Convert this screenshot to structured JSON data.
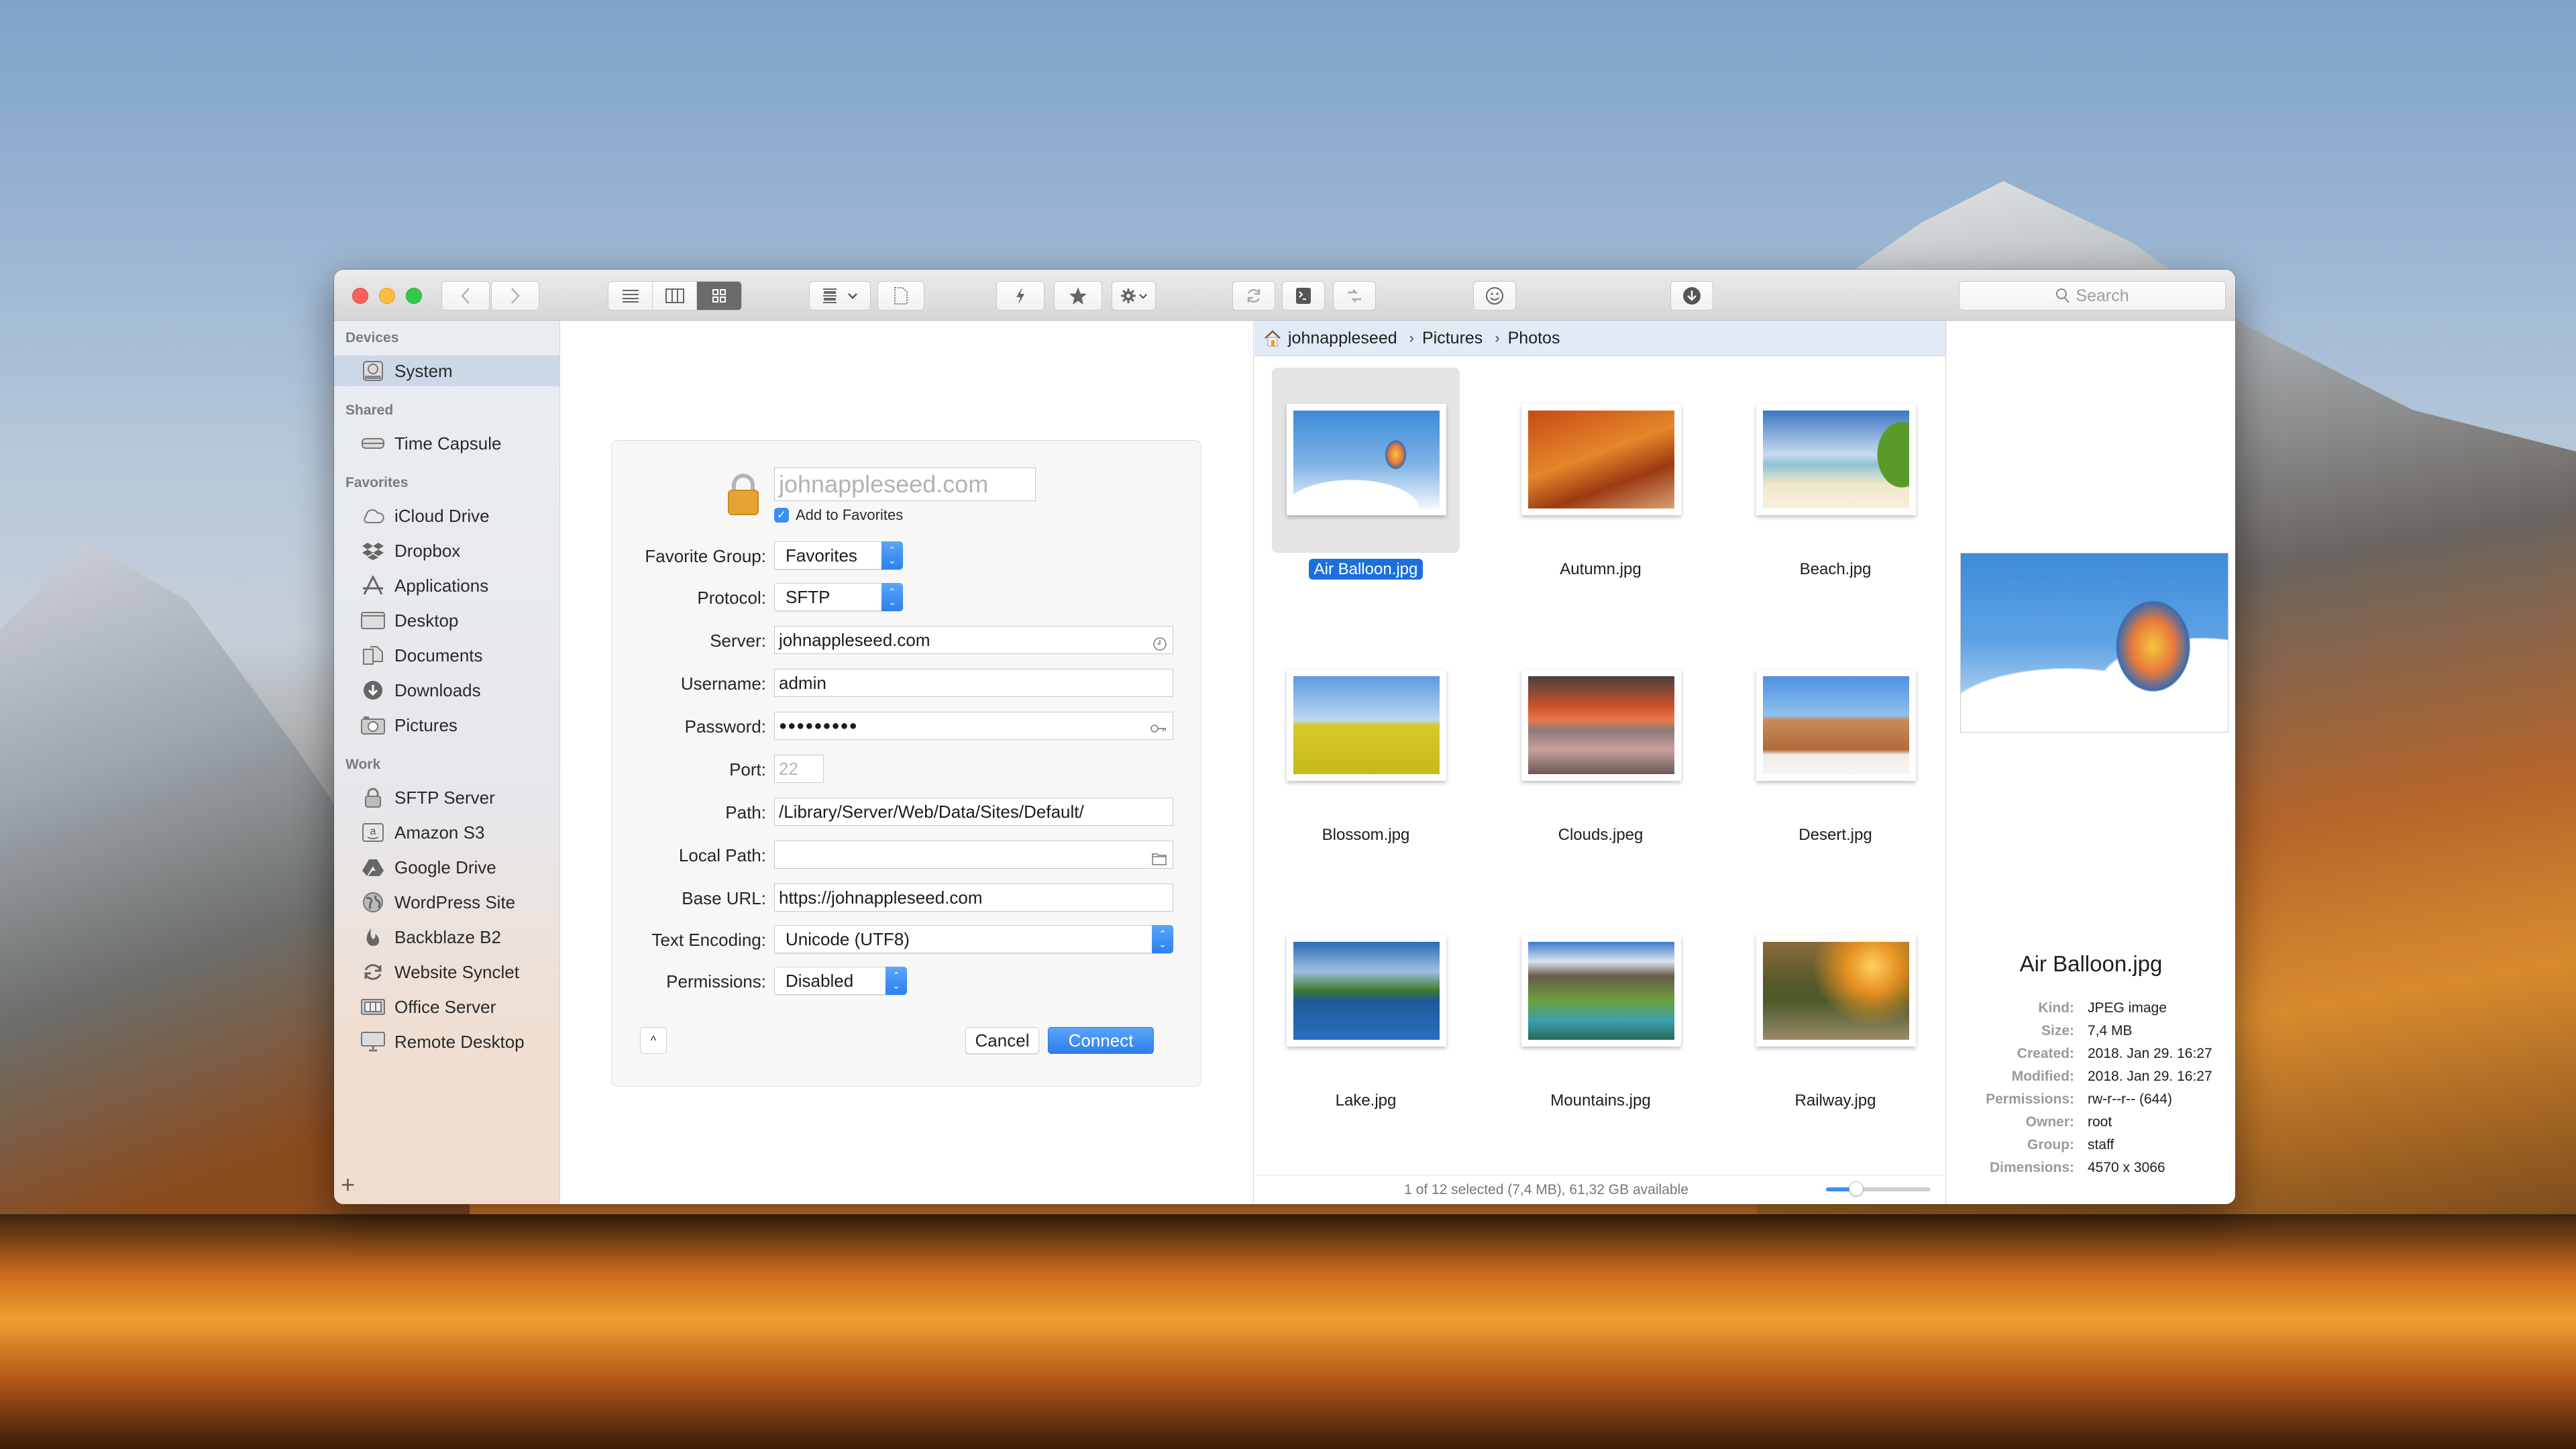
{
  "toolbar": {
    "window_controls": [
      "close",
      "minimize",
      "maximize"
    ],
    "nav": [
      "back",
      "forward"
    ],
    "view_modes": [
      {
        "name": "list",
        "icon": "list-icon",
        "active": false
      },
      {
        "name": "columns",
        "icon": "columns-icon",
        "active": false
      },
      {
        "name": "icons",
        "icon": "grid-icon",
        "active": true
      }
    ],
    "buttons": [
      {
        "name": "arrange",
        "icon": "arrange-icon"
      },
      {
        "name": "new-file",
        "icon": "new-file-icon"
      },
      {
        "name": "quick-connect",
        "icon": "lightning-icon"
      },
      {
        "name": "favorites",
        "icon": "star-icon"
      },
      {
        "name": "action",
        "icon": "gear-icon"
      },
      {
        "name": "sync",
        "icon": "sync-icon"
      },
      {
        "name": "terminal",
        "icon": "terminal-icon"
      },
      {
        "name": "transfer",
        "icon": "transfer-icon"
      },
      {
        "name": "emoji",
        "icon": "smiley-icon"
      },
      {
        "name": "download",
        "icon": "download-icon"
      }
    ],
    "search_placeholder": "Search"
  },
  "sidebar": {
    "sections": [
      {
        "title": "Devices",
        "items": [
          {
            "label": "System",
            "icon": "hard-drive-icon",
            "selected": true
          }
        ]
      },
      {
        "title": "Shared",
        "items": [
          {
            "label": "Time Capsule",
            "icon": "time-capsule-icon"
          }
        ]
      },
      {
        "title": "Favorites",
        "items": [
          {
            "label": "iCloud Drive",
            "icon": "cloud-icon"
          },
          {
            "label": "Dropbox",
            "icon": "dropbox-icon"
          },
          {
            "label": "Applications",
            "icon": "applications-icon"
          },
          {
            "label": "Desktop",
            "icon": "desktop-icon"
          },
          {
            "label": "Documents",
            "icon": "documents-icon"
          },
          {
            "label": "Downloads",
            "icon": "downloads-icon"
          },
          {
            "label": "Pictures",
            "icon": "camera-icon"
          }
        ]
      },
      {
        "title": "Work",
        "items": [
          {
            "label": "SFTP Server",
            "icon": "lock-icon"
          },
          {
            "label": "Amazon S3",
            "icon": "amazon-icon"
          },
          {
            "label": "Google Drive",
            "icon": "google-drive-icon"
          },
          {
            "label": "WordPress Site",
            "icon": "globe-icon"
          },
          {
            "label": "Backblaze B2",
            "icon": "flame-icon"
          },
          {
            "label": "Website Synclet",
            "icon": "sync-icon"
          },
          {
            "label": "Office Server",
            "icon": "server-icon"
          },
          {
            "label": "Remote Desktop",
            "icon": "monitor-icon"
          }
        ]
      }
    ],
    "add_label": "+"
  },
  "form": {
    "name_placeholder": "johnappleseed.com",
    "add_to_favorites": {
      "label": "Add to Favorites",
      "checked": true
    },
    "fields": {
      "favorite_group": {
        "label": "Favorite Group:",
        "value": "Favorites"
      },
      "protocol": {
        "label": "Protocol:",
        "value": "SFTP"
      },
      "server": {
        "label": "Server:",
        "value": "johnappleseed.com"
      },
      "username": {
        "label": "Username:",
        "value": "admin"
      },
      "password": {
        "label": "Password:",
        "value": "●●●●●●●●●"
      },
      "port": {
        "label": "Port:",
        "placeholder": "22"
      },
      "path": {
        "label": "Path:",
        "value": "/Library/Server/Web/Data/Sites/Default/"
      },
      "local_path": {
        "label": "Local Path:",
        "value": ""
      },
      "base_url": {
        "label": "Base URL:",
        "value": "https://johnappleseed.com"
      },
      "text_encoding": {
        "label": "Text Encoding:",
        "value": "Unicode (UTF8)"
      },
      "permissions": {
        "label": "Permissions:",
        "value": "Disabled"
      }
    },
    "cancel_label": "Cancel",
    "connect_label": "Connect",
    "expand_label": "^"
  },
  "browser": {
    "breadcrumb": [
      "johnappleseed",
      "Pictures",
      "Photos"
    ],
    "files": [
      {
        "name": "Air Balloon.jpg",
        "selected": true
      },
      {
        "name": "Autumn.jpg"
      },
      {
        "name": "Beach.jpg"
      },
      {
        "name": "Blossom.jpg"
      },
      {
        "name": "Clouds.jpeg"
      },
      {
        "name": "Desert.jpg"
      },
      {
        "name": "Lake.jpg"
      },
      {
        "name": "Mountains.jpg"
      },
      {
        "name": "Railway.jpg"
      }
    ],
    "status": "1 of 12 selected (7,4 MB), 61,32 GB available",
    "zoom_level": 0.25
  },
  "preview": {
    "title": "Air Balloon.jpg",
    "meta": [
      {
        "key": "Kind:",
        "value": "JPEG image"
      },
      {
        "key": "Size:",
        "value": "7,4 MB"
      },
      {
        "key": "Created:",
        "value": "2018. Jan 29. 16:27"
      },
      {
        "key": "Modified:",
        "value": "2018. Jan 29. 16:27"
      },
      {
        "key": "Permissions:",
        "value": "rw-r--r-- (644)"
      },
      {
        "key": "Owner:",
        "value": "root"
      },
      {
        "key": "Group:",
        "value": "staff"
      },
      {
        "key": "Dimensions:",
        "value": "4570 x 3066"
      }
    ]
  },
  "colors": {
    "accent": "#2c7fef",
    "selection": "#1d6fdd",
    "sidebar_selected": "#ccd8e6",
    "breadcrumb_bg": "#e2eaf6"
  }
}
